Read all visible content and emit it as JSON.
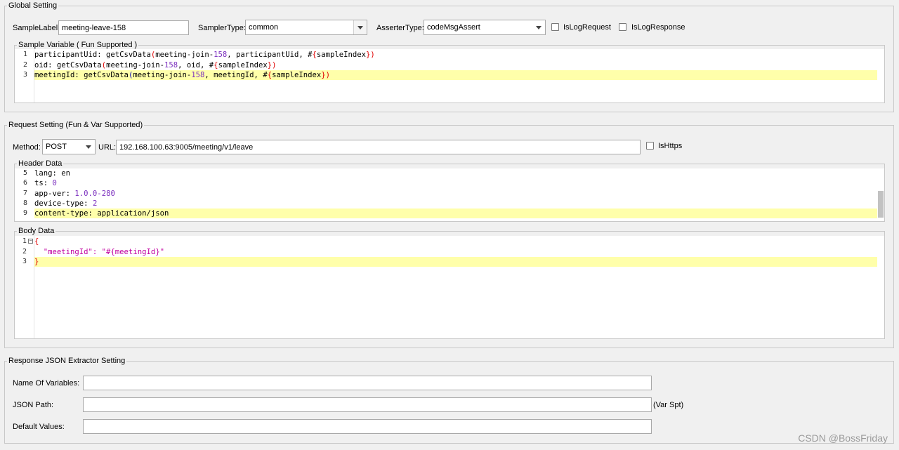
{
  "global": {
    "title": "Global Setting",
    "sample_label_label": "SampleLabel:",
    "sample_label_value": "meeting-leave-158",
    "sampler_type_label": "SamplerType:",
    "sampler_type_value": "common",
    "asserter_type_label": "AsserterType:",
    "asserter_type_value": "codeMsgAssert",
    "is_log_request": "IsLogRequest",
    "is_log_response": "IsLogResponse",
    "sample_variable_title": "Sample Variable ( Fun Supported )",
    "sample_variable_lines": [
      {
        "n": "1",
        "parts": [
          [
            "participantUid: getCsvData",
            "k"
          ],
          [
            "(",
            "br"
          ],
          [
            "meeting-join-",
            "k"
          ],
          [
            "158",
            "num"
          ],
          [
            ", participantUid, ",
            "k"
          ],
          [
            "#",
            "k"
          ],
          [
            "{",
            "br"
          ],
          [
            "sampleIndex",
            "k"
          ],
          [
            "})",
            "br"
          ]
        ]
      },
      {
        "n": "2",
        "parts": [
          [
            "oid: getCsvData",
            "k"
          ],
          [
            "(",
            "br"
          ],
          [
            "meeting-join-",
            "k"
          ],
          [
            "158",
            "num"
          ],
          [
            ", oid, ",
            "k"
          ],
          [
            "#",
            "k"
          ],
          [
            "{",
            "br"
          ],
          [
            "sampleIndex",
            "k"
          ],
          [
            "})",
            "br"
          ]
        ]
      },
      {
        "n": "3",
        "parts": [
          [
            "meetingId: getCsvData",
            "k"
          ],
          [
            "(",
            "bl"
          ],
          [
            "meeting-join-",
            "k"
          ],
          [
            "158",
            "num"
          ],
          [
            ", meetingId, ",
            "k"
          ],
          [
            "#",
            "k"
          ],
          [
            "{",
            "br"
          ],
          [
            "sampleIndex",
            "k"
          ],
          [
            "})",
            "br"
          ]
        ]
      }
    ]
  },
  "request": {
    "title": "Request Setting (Fun & Var Supported)",
    "method_label": "Method:",
    "method_value": "POST",
    "url_label": "URL:",
    "url_value": "192.168.100.63:9005/meeting/v1/leave",
    "is_https": "IsHttps",
    "header_title": "Header Data",
    "header_lines": [
      {
        "n": "5",
        "key": "lang",
        "sep": ": ",
        "val": "en",
        "cls": "k"
      },
      {
        "n": "6",
        "key": "ts",
        "sep": ": ",
        "val": "0",
        "cls": "num"
      },
      {
        "n": "7",
        "key": "app-ver",
        "sep": ": ",
        "val": "1.0.0-280",
        "cls": "num"
      },
      {
        "n": "8",
        "key": "device-type",
        "sep": ": ",
        "val": "2",
        "cls": "num"
      },
      {
        "n": "9",
        "key": "content-type",
        "sep": ": ",
        "val": "application/json",
        "cls": "k"
      }
    ],
    "body_title": "Body Data",
    "body_lines": [
      {
        "n": "1",
        "text": "{",
        "cls": "br"
      },
      {
        "n": "2",
        "text": "  \"meetingId\": \"#{meetingId}\"",
        "cls": "str"
      },
      {
        "n": "3",
        "text": "}",
        "cls": "br"
      }
    ]
  },
  "extractor": {
    "title": "Response JSON Extractor Setting",
    "names_label": "Name Of Variables:",
    "names_value": "",
    "path_label": "JSON Path:",
    "path_value": "",
    "path_hint": "(Var Spt)",
    "defaults_label": "Default Values:",
    "defaults_value": ""
  },
  "watermark": "CSDN @BossFriday"
}
